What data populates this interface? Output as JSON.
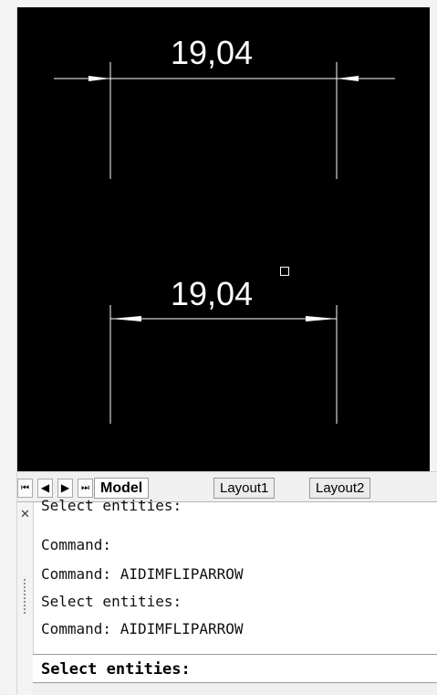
{
  "drawing": {
    "dimension_top": "19,04",
    "dimension_bottom": "19,04"
  },
  "nav_buttons": {
    "first": "⏮",
    "prev": "◀",
    "next": "▶",
    "last": "⏭"
  },
  "tabs": [
    {
      "label": "Model",
      "active": true
    },
    {
      "label": "Layout1",
      "active": false
    },
    {
      "label": "Layout2",
      "active": false
    }
  ],
  "command": {
    "close_glyph": "✕",
    "history": [
      "Select entities:",
      "Command:",
      "Command: AIDIMFLIPARROW",
      "Select entities:",
      "Command: AIDIMFLIPARROW"
    ],
    "prompt": "Select entities:"
  },
  "colors": {
    "canvas": "#000000",
    "geometry": "#ffffff",
    "panel": "#ffffff"
  }
}
